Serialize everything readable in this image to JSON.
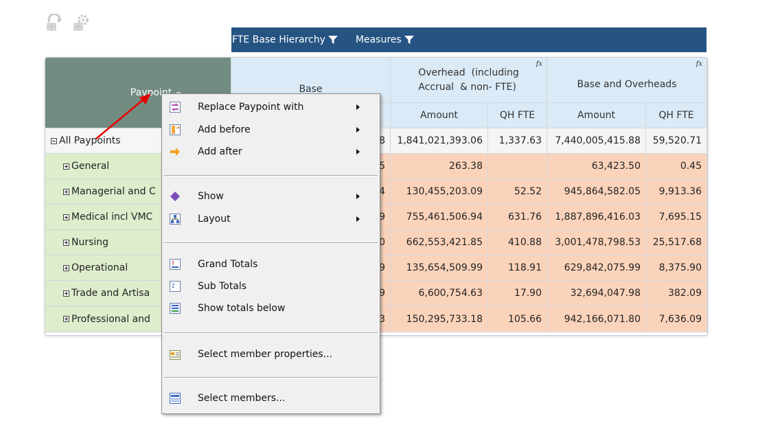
{
  "toolbar": {
    "icons": [
      "refresh-grid-icon",
      "settings-grid-icon"
    ]
  },
  "topbar": {
    "dim1": "FTE Base Hierarchy",
    "dim2": "Measures"
  },
  "grid": {
    "corner_label": "Paypoint",
    "groups": [
      {
        "label": "Base",
        "fx": ""
      },
      {
        "label": "Overhead  (including\nAccrual  & non- FTE)",
        "fx": "fx"
      },
      {
        "label": "Base and Overheads",
        "fx": "fx"
      }
    ],
    "subheaders": [
      "Amount",
      "QH FTE",
      "Amount",
      "QH FTE"
    ],
    "rows": [
      {
        "label": "All Paypoints",
        "base_tail": "8",
        "cells": [
          "1,841,021,393.06",
          "1,337.63",
          "7,440,005,415.88",
          "59,520.71"
        ]
      },
      {
        "label": "General",
        "base_tail": "5",
        "cells": [
          "263.38",
          "",
          "63,423.50",
          "0.45"
        ]
      },
      {
        "label": "Managerial and C",
        "base_tail": "4",
        "cells": [
          "130,455,203.09",
          "52.52",
          "945,864,582.05",
          "9,913.36"
        ]
      },
      {
        "label": "Medical incl VMC",
        "base_tail": "9",
        "cells": [
          "755,461,506.94",
          "631.76",
          "1,887,896,416.03",
          "7,695.15"
        ]
      },
      {
        "label": "Nursing",
        "base_tail": "0",
        "cells": [
          "662,553,421.85",
          "410.88",
          "3,001,478,798.53",
          "25,517.68"
        ]
      },
      {
        "label": "Operational",
        "base_tail": "9",
        "cells": [
          "135,654,509.99",
          "118.91",
          "629,842,075.99",
          "8,375.90"
        ]
      },
      {
        "label": "Trade and Artisa",
        "base_tail": "9",
        "cells": [
          "6,600,754.63",
          "17.90",
          "32,694,047.98",
          "382.09"
        ]
      },
      {
        "label": "Professional and",
        "base_tail": "3",
        "cells": [
          "150,295,733.18",
          "105.66",
          "942,166,071.80",
          "7,636.09"
        ]
      }
    ]
  },
  "menu": {
    "items": [
      {
        "label": "Replace Paypoint with",
        "icon": "replace-icon",
        "submenu": true
      },
      {
        "label": "Add before",
        "icon": "add-before-icon",
        "submenu": true
      },
      {
        "label": "Add after",
        "icon": "add-after-icon",
        "submenu": true
      },
      {
        "label": "Show",
        "icon": "show-icon",
        "submenu": true
      },
      {
        "label": "Layout",
        "icon": "layout-icon",
        "submenu": true
      },
      {
        "label": "Grand Totals",
        "icon": "grand-totals-icon",
        "submenu": false
      },
      {
        "label": "Sub Totals",
        "icon": "sub-totals-icon",
        "submenu": false
      },
      {
        "label": "Show totals below",
        "icon": "totals-below-icon",
        "submenu": false
      },
      {
        "label": "Select member properties...",
        "icon": "member-properties-icon",
        "submenu": false
      },
      {
        "label": "Select members...",
        "icon": "select-members-icon",
        "submenu": false
      }
    ]
  }
}
